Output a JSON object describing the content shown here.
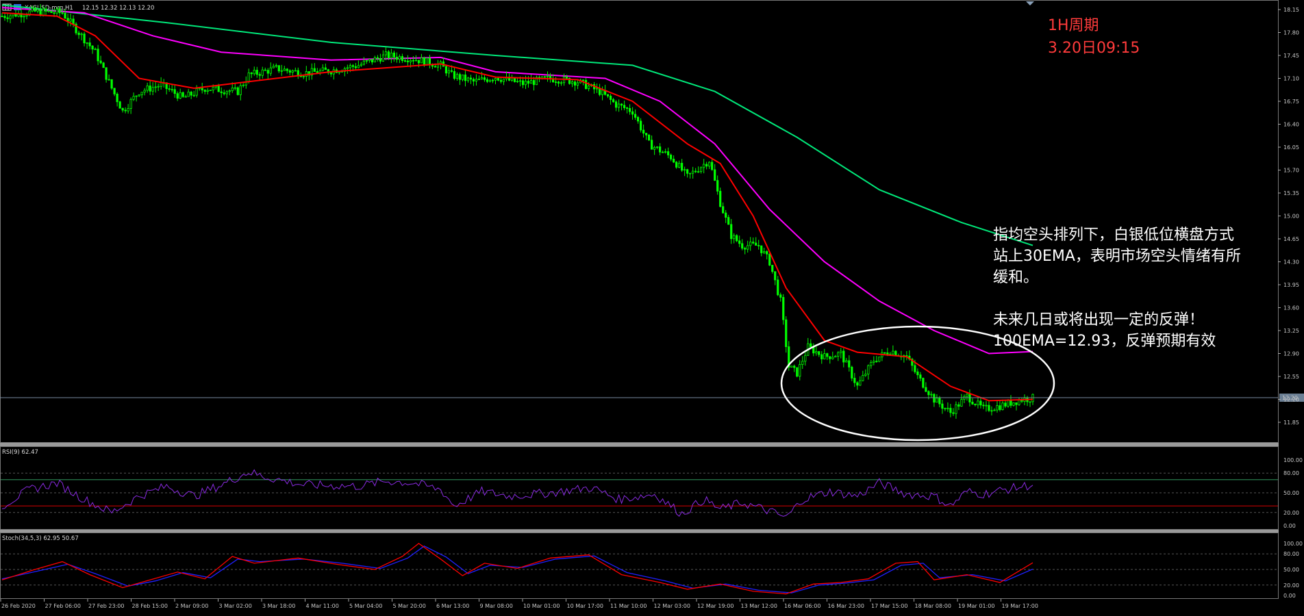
{
  "header": {
    "symbol_label": "XAGUSD-mrg,H1",
    "ohlc": "12.15 12.32 12.13 12.20"
  },
  "colors": {
    "background": "#000000",
    "candle_up": "#00ff00",
    "candle_down": "#00ff00",
    "ema30": "#ff0000",
    "ema100": "#ff00ff",
    "ema200": "#00e87a",
    "rsi_line": "#8a2be2",
    "stoch_main": "#ff0000",
    "stoch_signal": "#2020ff",
    "rsi_upper_level": "#2e8b57",
    "rsi_lower_level": "#c00000",
    "annotation_red": "#ff3b3b",
    "annotation_white": "#ffffff",
    "ellipse": "#ffffff",
    "grid": "#555555"
  },
  "annotations": {
    "period_label": "1H周期",
    "date_label": "3.20日09:15",
    "comment_lines": [
      "指均空头排列下，白银低位横盘方式",
      "站上30EMA，表明市场空头情绪有所",
      "缓和。",
      "",
      "未来几日或将出现一定的反弹！",
      "100EMA=12.93，反弹预期有效"
    ]
  },
  "price_scale": {
    "ticks": [
      "18.15",
      "17.80",
      "17.45",
      "17.10",
      "16.75",
      "16.40",
      "16.05",
      "15.70",
      "15.35",
      "15.00",
      "14.65",
      "14.30",
      "13.95",
      "13.60",
      "13.25",
      "12.90",
      "12.55",
      "12.20",
      "11.85"
    ],
    "current_price_label": "12.20"
  },
  "time_axis": {
    "labels": [
      "26 Feb 2020",
      "27 Feb 06:00",
      "27 Feb 23:00",
      "28 Feb 15:00",
      "2 Mar 09:00",
      "3 Mar 02:00",
      "3 Mar 18:00",
      "4 Mar 11:00",
      "5 Mar 04:00",
      "5 Mar 20:00",
      "6 Mar 13:00",
      "9 Mar 08:00",
      "10 Mar 01:00",
      "10 Mar 17:00",
      "11 Mar 10:00",
      "12 Mar 03:00",
      "12 Mar 19:00",
      "13 Mar 12:00",
      "16 Mar 06:00",
      "16 Mar 23:00",
      "17 Mar 15:00",
      "18 Mar 08:00",
      "19 Mar 01:00",
      "19 Mar 17:00"
    ]
  },
  "rsi_panel": {
    "label": "RSI(9) 62.47",
    "ticks": [
      "100.00",
      "80.00",
      "50.00",
      "20.00",
      "0.00"
    ],
    "levels": [
      70,
      30
    ]
  },
  "stoch_panel": {
    "label": "Stoch(34,5,3) 62.95 50.67",
    "ticks": [
      "100.00",
      "80.00",
      "50.00",
      "20.00",
      "0.00"
    ]
  },
  "chart_data": {
    "type": "candlestick",
    "title": "XAGUSD-mrg,H1",
    "ylim": [
      11.6,
      18.3
    ],
    "price_path": [
      [
        0,
        18.05
      ],
      [
        12,
        18.12
      ],
      [
        22,
        18.1
      ],
      [
        30,
        17.7
      ],
      [
        34,
        17.5
      ],
      [
        40,
        16.95
      ],
      [
        44,
        16.6
      ],
      [
        50,
        16.9
      ],
      [
        58,
        17.0
      ],
      [
        66,
        16.8
      ],
      [
        74,
        16.95
      ],
      [
        86,
        16.9
      ],
      [
        90,
        17.15
      ],
      [
        100,
        17.25
      ],
      [
        110,
        17.18
      ],
      [
        120,
        17.22
      ],
      [
        130,
        17.3
      ],
      [
        140,
        17.45
      ],
      [
        150,
        17.4
      ],
      [
        160,
        17.3
      ],
      [
        164,
        17.15
      ],
      [
        172,
        17.05
      ],
      [
        180,
        17.12
      ],
      [
        190,
        17.02
      ],
      [
        200,
        17.1
      ],
      [
        210,
        17.05
      ],
      [
        218,
        16.9
      ],
      [
        224,
        16.7
      ],
      [
        230,
        16.6
      ],
      [
        236,
        16.1
      ],
      [
        244,
        15.9
      ],
      [
        250,
        15.6
      ],
      [
        258,
        15.85
      ],
      [
        262,
        15.2
      ],
      [
        266,
        14.7
      ],
      [
        270,
        14.55
      ],
      [
        276,
        14.55
      ],
      [
        280,
        14.3
      ],
      [
        284,
        13.7
      ],
      [
        287,
        12.7
      ],
      [
        290,
        12.6
      ],
      [
        294,
        13.0
      ],
      [
        300,
        12.85
      ],
      [
        306,
        12.9
      ],
      [
        312,
        12.4
      ],
      [
        318,
        12.8
      ],
      [
        324,
        12.95
      ],
      [
        330,
        12.85
      ],
      [
        334,
        12.55
      ],
      [
        340,
        12.2
      ],
      [
        346,
        12.0
      ],
      [
        352,
        12.25
      ],
      [
        358,
        12.05
      ],
      [
        364,
        12.1
      ],
      [
        372,
        12.2
      ],
      [
        376,
        12.22
      ]
    ],
    "ema30_path": [
      [
        0,
        18.1
      ],
      [
        20,
        18.05
      ],
      [
        34,
        17.75
      ],
      [
        50,
        17.1
      ],
      [
        70,
        16.95
      ],
      [
        90,
        17.05
      ],
      [
        120,
        17.2
      ],
      [
        160,
        17.32
      ],
      [
        180,
        17.12
      ],
      [
        210,
        17.08
      ],
      [
        230,
        16.75
      ],
      [
        250,
        16.1
      ],
      [
        262,
        15.8
      ],
      [
        274,
        15.0
      ],
      [
        286,
        13.9
      ],
      [
        300,
        13.1
      ],
      [
        312,
        12.92
      ],
      [
        330,
        12.85
      ],
      [
        346,
        12.4
      ],
      [
        360,
        12.18
      ],
      [
        376,
        12.2
      ]
    ],
    "ema100_path": [
      [
        0,
        18.18
      ],
      [
        30,
        18.1
      ],
      [
        55,
        17.75
      ],
      [
        80,
        17.5
      ],
      [
        120,
        17.38
      ],
      [
        160,
        17.42
      ],
      [
        180,
        17.2
      ],
      [
        220,
        17.1
      ],
      [
        240,
        16.75
      ],
      [
        260,
        16.1
      ],
      [
        280,
        15.1
      ],
      [
        300,
        14.3
      ],
      [
        320,
        13.7
      ],
      [
        340,
        13.25
      ],
      [
        360,
        12.9
      ],
      [
        376,
        12.93
      ]
    ],
    "ema200_path": [
      [
        0,
        18.22
      ],
      [
        60,
        17.95
      ],
      [
        120,
        17.65
      ],
      [
        180,
        17.45
      ],
      [
        230,
        17.3
      ],
      [
        260,
        16.9
      ],
      [
        290,
        16.2
      ],
      [
        320,
        15.4
      ],
      [
        350,
        14.9
      ],
      [
        376,
        14.55
      ]
    ],
    "rsi9_path": [
      [
        0,
        30
      ],
      [
        10,
        55
      ],
      [
        20,
        65
      ],
      [
        30,
        40
      ],
      [
        40,
        20
      ],
      [
        50,
        45
      ],
      [
        60,
        60
      ],
      [
        70,
        45
      ],
      [
        80,
        62
      ],
      [
        90,
        82
      ],
      [
        95,
        75
      ],
      [
        110,
        62
      ],
      [
        130,
        60
      ],
      [
        140,
        68
      ],
      [
        150,
        65
      ],
      [
        160,
        55
      ],
      [
        165,
        30
      ],
      [
        175,
        52
      ],
      [
        185,
        45
      ],
      [
        200,
        50
      ],
      [
        215,
        58
      ],
      [
        225,
        40
      ],
      [
        238,
        48
      ],
      [
        248,
        18
      ],
      [
        256,
        40
      ],
      [
        262,
        25
      ],
      [
        270,
        35
      ],
      [
        280,
        22
      ],
      [
        286,
        12
      ],
      [
        292,
        40
      ],
      [
        302,
        52
      ],
      [
        312,
        45
      ],
      [
        320,
        65
      ],
      [
        330,
        48
      ],
      [
        340,
        45
      ],
      [
        346,
        30
      ],
      [
        352,
        52
      ],
      [
        358,
        48
      ],
      [
        366,
        55
      ],
      [
        376,
        62.47
      ]
    ],
    "stoch_main_path": [
      [
        0,
        30
      ],
      [
        12,
        50
      ],
      [
        22,
        65
      ],
      [
        32,
        40
      ],
      [
        44,
        15
      ],
      [
        54,
        30
      ],
      [
        64,
        45
      ],
      [
        74,
        32
      ],
      [
        84,
        75
      ],
      [
        92,
        62
      ],
      [
        108,
        72
      ],
      [
        122,
        60
      ],
      [
        136,
        50
      ],
      [
        146,
        75
      ],
      [
        152,
        100
      ],
      [
        160,
        70
      ],
      [
        168,
        38
      ],
      [
        176,
        62
      ],
      [
        188,
        52
      ],
      [
        200,
        72
      ],
      [
        214,
        78
      ],
      [
        226,
        40
      ],
      [
        240,
        25
      ],
      [
        250,
        12
      ],
      [
        262,
        22
      ],
      [
        274,
        8
      ],
      [
        286,
        3
      ],
      [
        296,
        22
      ],
      [
        306,
        25
      ],
      [
        316,
        32
      ],
      [
        326,
        62
      ],
      [
        334,
        65
      ],
      [
        340,
        30
      ],
      [
        352,
        40
      ],
      [
        364,
        25
      ],
      [
        376,
        62.95
      ]
    ],
    "stoch_signal_path": [
      [
        0,
        32
      ],
      [
        14,
        48
      ],
      [
        24,
        60
      ],
      [
        34,
        42
      ],
      [
        46,
        18
      ],
      [
        56,
        28
      ],
      [
        66,
        44
      ],
      [
        76,
        34
      ],
      [
        86,
        70
      ],
      [
        94,
        65
      ],
      [
        110,
        70
      ],
      [
        124,
        62
      ],
      [
        138,
        52
      ],
      [
        148,
        72
      ],
      [
        154,
        95
      ],
      [
        162,
        74
      ],
      [
        170,
        42
      ],
      [
        178,
        58
      ],
      [
        190,
        54
      ],
      [
        202,
        70
      ],
      [
        216,
        76
      ],
      [
        228,
        44
      ],
      [
        242,
        28
      ],
      [
        252,
        14
      ],
      [
        264,
        22
      ],
      [
        276,
        10
      ],
      [
        288,
        5
      ],
      [
        298,
        20
      ],
      [
        308,
        24
      ],
      [
        318,
        30
      ],
      [
        328,
        58
      ],
      [
        336,
        62
      ],
      [
        342,
        34
      ],
      [
        354,
        40
      ],
      [
        366,
        28
      ],
      [
        376,
        50.67
      ]
    ]
  }
}
